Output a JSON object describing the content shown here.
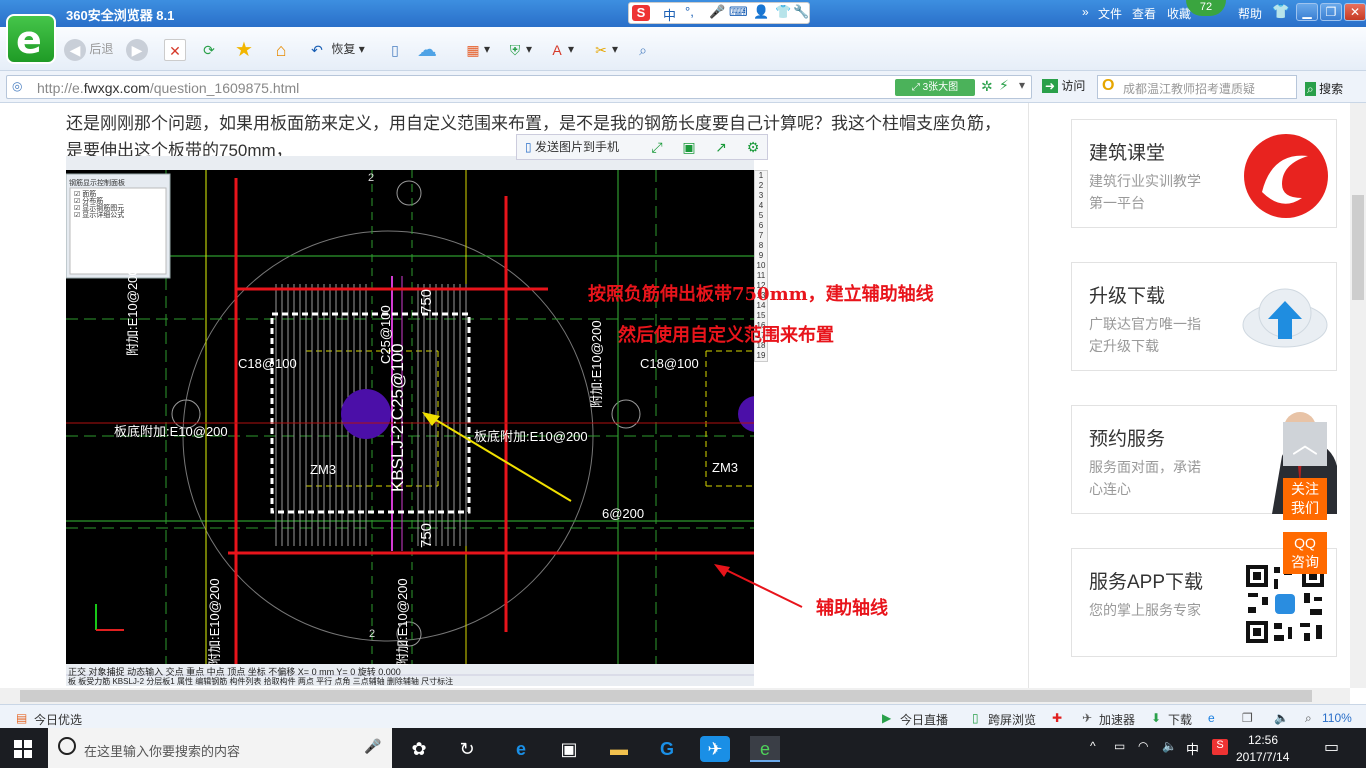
{
  "browser": {
    "title": "360安全浏览器 8.1",
    "menu": [
      "文件",
      "查看",
      "收藏",
      "帮助"
    ],
    "score_badge": "72",
    "ime": {
      "s": "S",
      "label": "中"
    }
  },
  "toolbar": {
    "back_label": "后退",
    "restore_label": "恢复"
  },
  "address_bar": {
    "url_prefix": "http://e.",
    "url_domain": "fwxgx.com",
    "url_path": "/question_1609875.html",
    "big_image_label": "3张大图",
    "visit_label": "访问",
    "search_placeholder": "成都温江教师招考遭质疑",
    "search_label": "搜索"
  },
  "question": {
    "text": "还是刚刚那个问题，如果用板面筋来定义，用自定义范围来布置，是不是我的钢筋长度要自己计算呢？我这个柱帽支座负筋，是要伸出这个板带的750mm，"
  },
  "image_toolbar": {
    "send_label": "发送图片到手机"
  },
  "screenshot": {
    "panel_title": "钢筋显示控制面板",
    "panel_items": [
      "面筋",
      "分布筋",
      "显示钢筋图元",
      "显示详细公式"
    ],
    "labels": {
      "c18_left": "C18@100",
      "c18_right": "C18@100",
      "c25": "C25@100",
      "kbslj": "KBSLJ-2:C25@100",
      "fj_left": "附加:E10@200",
      "fj_right": "附加:E10@200",
      "bd_left": "板底附加:E10@200",
      "bd_right": "板底附加:E10@200",
      "zm3_left": "ZM3",
      "zm3_right": "ZM3",
      "dim_top": "750",
      "dim_bottom": "750",
      "axis_2_top": "2",
      "axis_2_bottom": "2",
      "fj_bottom_left": "附加:E10@200",
      "fj_bottom_mid": "附加:E10@200",
      "bottom_right": "6@200"
    },
    "annotation_line1": "按照负筋伸出板带750mm，建立辅助轴线",
    "annotation_line2": "然后使用自定义范围来布置",
    "annotation_aux": "辅助轴线",
    "ruler": [
      "1",
      "2",
      "3",
      "4",
      "5",
      "6",
      "7",
      "8",
      "9",
      "10",
      "11",
      "12",
      "13",
      "14",
      "15",
      "16",
      "17",
      "18",
      "19"
    ],
    "status_items": [
      "正交",
      "对象捕捉",
      "动态输入",
      "交点",
      "重点",
      "中点",
      "顶点",
      "坐标",
      "不偏移",
      "X=",
      "0",
      "mm Y=",
      "0",
      "旋转",
      "0.000"
    ],
    "status_items2": [
      "板",
      "板受力筋",
      "KBSLJ-2",
      "分层板1",
      "属性",
      "编辑钢筋",
      "构件列表",
      "拾取构件",
      "两点",
      "平行",
      "点角",
      "三点辅轴",
      "删除辅轴",
      "尺寸标注"
    ]
  },
  "sidebar": {
    "cards": [
      {
        "title": "建筑课堂",
        "desc": "建筑行业实训教学第一平台"
      },
      {
        "title": "升级下载",
        "desc": "广联达官方唯一指定升级下载"
      },
      {
        "title": "预约服务",
        "desc": "服务面对面，承诺心连心"
      },
      {
        "title": "服务APP下载",
        "desc": "您的掌上服务专家"
      }
    ],
    "follow_label": "关注我们",
    "qq_label": "QQ咨询"
  },
  "statusbar": {
    "left": "今日优选",
    "items": [
      "今日直播",
      "跨屏浏览",
      "加速器",
      "下载",
      "110%"
    ]
  },
  "taskbar": {
    "search_placeholder": "在这里输入你要搜索的内容",
    "ime": "中",
    "time": "12:56",
    "date": "2017/7/14"
  }
}
